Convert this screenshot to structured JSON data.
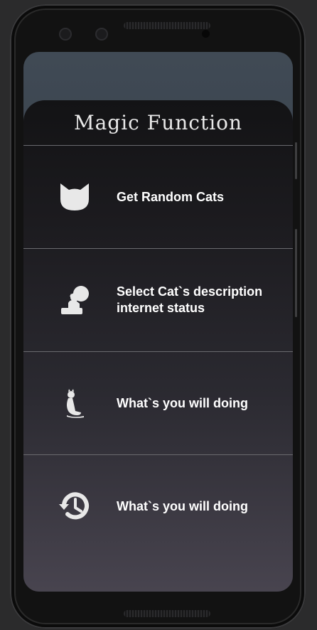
{
  "sheet": {
    "title": "Magic Function"
  },
  "menu": {
    "items": [
      {
        "label": "Get Random Cats",
        "icon": "cat-face-icon"
      },
      {
        "label": "Select Cat`s description internet status",
        "icon": "cat-moon-icon"
      },
      {
        "label": "What`s you will doing",
        "icon": "sitting-cat-icon"
      },
      {
        "label": "What`s you will doing",
        "icon": "history-icon"
      }
    ]
  },
  "colors": {
    "sheet_top": "#131315",
    "sheet_bottom": "#48444f",
    "screen_top": "#404a55",
    "divider": "#6a6a6e",
    "text": "#ffffff",
    "icon": "#e8e8e8"
  }
}
